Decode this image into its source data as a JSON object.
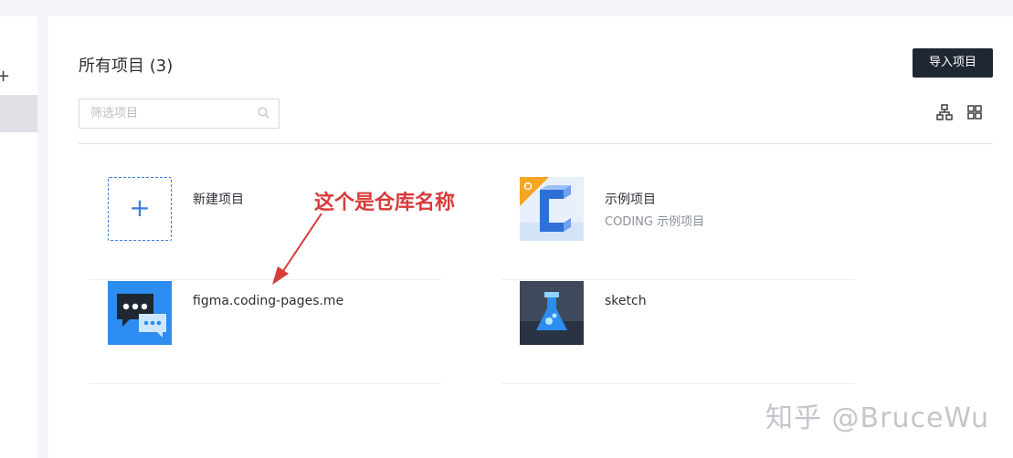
{
  "sidebar": {
    "plus_symbol": "+"
  },
  "header": {
    "title": "所有项目 (3)",
    "import_label": "导入项目"
  },
  "filter": {
    "placeholder": "筛选项目"
  },
  "projects": [
    {
      "name": "新建项目",
      "description": "",
      "thumb": "plus-icon",
      "symbol": "+"
    },
    {
      "name": "示例项目",
      "description": "CODING 示例项目",
      "thumb": "coding-logo"
    },
    {
      "name": "figma.coding-pages.me",
      "description": "",
      "thumb": "chat-icon"
    },
    {
      "name": "sketch",
      "description": "",
      "thumb": "flask-icon"
    }
  ],
  "annotation": {
    "text": "这个是仓库名称",
    "color": "#d93a3a"
  },
  "watermark": {
    "text": "知乎 @BruceWu"
  },
  "colors": {
    "accent": "#3d7be0",
    "dark_button": "#1f2733"
  }
}
